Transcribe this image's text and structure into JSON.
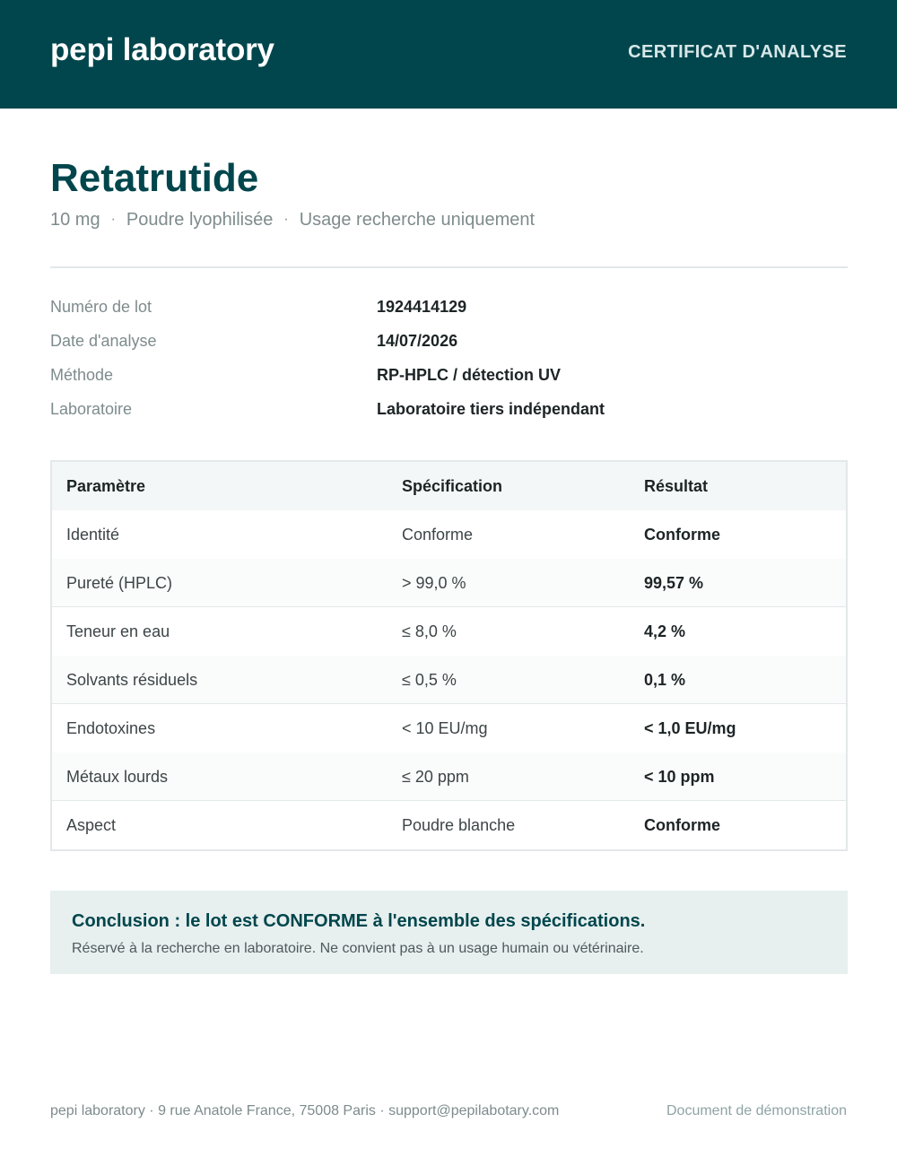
{
  "header": {
    "brand": "pepi laboratory",
    "document_type": "CERTIFICAT D'ANALYSE",
    "background_color": "#00464c"
  },
  "product": {
    "name": "Retatrutide",
    "dosage": "10 mg",
    "form": "Poudre lyophilisée",
    "usage": "Usage recherche uniquement",
    "separator": "·"
  },
  "info": [
    {
      "label": "Numéro de lot",
      "value": "1924414129"
    },
    {
      "label": "Date d'analyse",
      "value": "14/07/2026"
    },
    {
      "label": "Méthode",
      "value": "RP-HPLC / détection UV"
    },
    {
      "label": "Laboratoire",
      "value": "Laboratoire tiers indépendant"
    }
  ],
  "table": {
    "headers": [
      "Paramètre",
      "Spécification",
      "Résultat"
    ],
    "rows": [
      {
        "parameter": "Identité",
        "specification": "Conforme",
        "result": "Conforme"
      },
      {
        "parameter": "Pureté (HPLC)",
        "specification": "> 99,0 %",
        "result": "99,57 %"
      },
      {
        "parameter": "Teneur en eau",
        "specification": "≤ 8,0 %",
        "result": "4,2 %"
      },
      {
        "parameter": "Solvants résiduels",
        "specification": "≤ 0,5 %",
        "result": "0,1 %"
      },
      {
        "parameter": "Endotoxines",
        "specification": "< 10 EU/mg",
        "result": "< 1,0 EU/mg"
      },
      {
        "parameter": "Métaux lourds",
        "specification": "≤ 20 ppm",
        "result": "< 10 ppm"
      },
      {
        "parameter": "Aspect",
        "specification": "Poudre blanche",
        "result": "Conforme"
      }
    ]
  },
  "conclusion": {
    "title": "Conclusion : le lot est CONFORME à l'ensemble des spécifications.",
    "note": "Réservé à la recherche en laboratoire. Ne convient pas à un usage humain ou vétérinaire."
  },
  "footer": {
    "left": "pepi laboratory · 9 rue Anatole France, 75008 Paris · support@pepilabotary.com",
    "right": "Document de démonstration"
  }
}
